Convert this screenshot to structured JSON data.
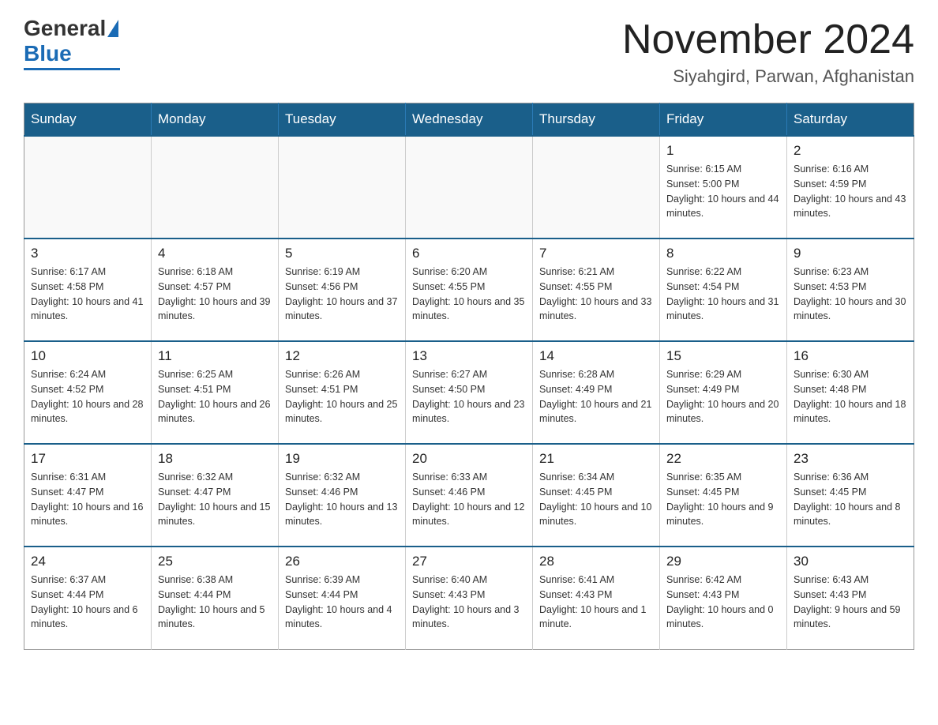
{
  "header": {
    "logo_general": "General",
    "logo_blue": "Blue",
    "title": "November 2024",
    "subtitle": "Siyahgird, Parwan, Afghanistan"
  },
  "days_of_week": [
    "Sunday",
    "Monday",
    "Tuesday",
    "Wednesday",
    "Thursday",
    "Friday",
    "Saturday"
  ],
  "weeks": [
    [
      {
        "day": "",
        "info": ""
      },
      {
        "day": "",
        "info": ""
      },
      {
        "day": "",
        "info": ""
      },
      {
        "day": "",
        "info": ""
      },
      {
        "day": "",
        "info": ""
      },
      {
        "day": "1",
        "info": "Sunrise: 6:15 AM\nSunset: 5:00 PM\nDaylight: 10 hours and 44 minutes."
      },
      {
        "day": "2",
        "info": "Sunrise: 6:16 AM\nSunset: 4:59 PM\nDaylight: 10 hours and 43 minutes."
      }
    ],
    [
      {
        "day": "3",
        "info": "Sunrise: 6:17 AM\nSunset: 4:58 PM\nDaylight: 10 hours and 41 minutes."
      },
      {
        "day": "4",
        "info": "Sunrise: 6:18 AM\nSunset: 4:57 PM\nDaylight: 10 hours and 39 minutes."
      },
      {
        "day": "5",
        "info": "Sunrise: 6:19 AM\nSunset: 4:56 PM\nDaylight: 10 hours and 37 minutes."
      },
      {
        "day": "6",
        "info": "Sunrise: 6:20 AM\nSunset: 4:55 PM\nDaylight: 10 hours and 35 minutes."
      },
      {
        "day": "7",
        "info": "Sunrise: 6:21 AM\nSunset: 4:55 PM\nDaylight: 10 hours and 33 minutes."
      },
      {
        "day": "8",
        "info": "Sunrise: 6:22 AM\nSunset: 4:54 PM\nDaylight: 10 hours and 31 minutes."
      },
      {
        "day": "9",
        "info": "Sunrise: 6:23 AM\nSunset: 4:53 PM\nDaylight: 10 hours and 30 minutes."
      }
    ],
    [
      {
        "day": "10",
        "info": "Sunrise: 6:24 AM\nSunset: 4:52 PM\nDaylight: 10 hours and 28 minutes."
      },
      {
        "day": "11",
        "info": "Sunrise: 6:25 AM\nSunset: 4:51 PM\nDaylight: 10 hours and 26 minutes."
      },
      {
        "day": "12",
        "info": "Sunrise: 6:26 AM\nSunset: 4:51 PM\nDaylight: 10 hours and 25 minutes."
      },
      {
        "day": "13",
        "info": "Sunrise: 6:27 AM\nSunset: 4:50 PM\nDaylight: 10 hours and 23 minutes."
      },
      {
        "day": "14",
        "info": "Sunrise: 6:28 AM\nSunset: 4:49 PM\nDaylight: 10 hours and 21 minutes."
      },
      {
        "day": "15",
        "info": "Sunrise: 6:29 AM\nSunset: 4:49 PM\nDaylight: 10 hours and 20 minutes."
      },
      {
        "day": "16",
        "info": "Sunrise: 6:30 AM\nSunset: 4:48 PM\nDaylight: 10 hours and 18 minutes."
      }
    ],
    [
      {
        "day": "17",
        "info": "Sunrise: 6:31 AM\nSunset: 4:47 PM\nDaylight: 10 hours and 16 minutes."
      },
      {
        "day": "18",
        "info": "Sunrise: 6:32 AM\nSunset: 4:47 PM\nDaylight: 10 hours and 15 minutes."
      },
      {
        "day": "19",
        "info": "Sunrise: 6:32 AM\nSunset: 4:46 PM\nDaylight: 10 hours and 13 minutes."
      },
      {
        "day": "20",
        "info": "Sunrise: 6:33 AM\nSunset: 4:46 PM\nDaylight: 10 hours and 12 minutes."
      },
      {
        "day": "21",
        "info": "Sunrise: 6:34 AM\nSunset: 4:45 PM\nDaylight: 10 hours and 10 minutes."
      },
      {
        "day": "22",
        "info": "Sunrise: 6:35 AM\nSunset: 4:45 PM\nDaylight: 10 hours and 9 minutes."
      },
      {
        "day": "23",
        "info": "Sunrise: 6:36 AM\nSunset: 4:45 PM\nDaylight: 10 hours and 8 minutes."
      }
    ],
    [
      {
        "day": "24",
        "info": "Sunrise: 6:37 AM\nSunset: 4:44 PM\nDaylight: 10 hours and 6 minutes."
      },
      {
        "day": "25",
        "info": "Sunrise: 6:38 AM\nSunset: 4:44 PM\nDaylight: 10 hours and 5 minutes."
      },
      {
        "day": "26",
        "info": "Sunrise: 6:39 AM\nSunset: 4:44 PM\nDaylight: 10 hours and 4 minutes."
      },
      {
        "day": "27",
        "info": "Sunrise: 6:40 AM\nSunset: 4:43 PM\nDaylight: 10 hours and 3 minutes."
      },
      {
        "day": "28",
        "info": "Sunrise: 6:41 AM\nSunset: 4:43 PM\nDaylight: 10 hours and 1 minute."
      },
      {
        "day": "29",
        "info": "Sunrise: 6:42 AM\nSunset: 4:43 PM\nDaylight: 10 hours and 0 minutes."
      },
      {
        "day": "30",
        "info": "Sunrise: 6:43 AM\nSunset: 4:43 PM\nDaylight: 9 hours and 59 minutes."
      }
    ]
  ]
}
